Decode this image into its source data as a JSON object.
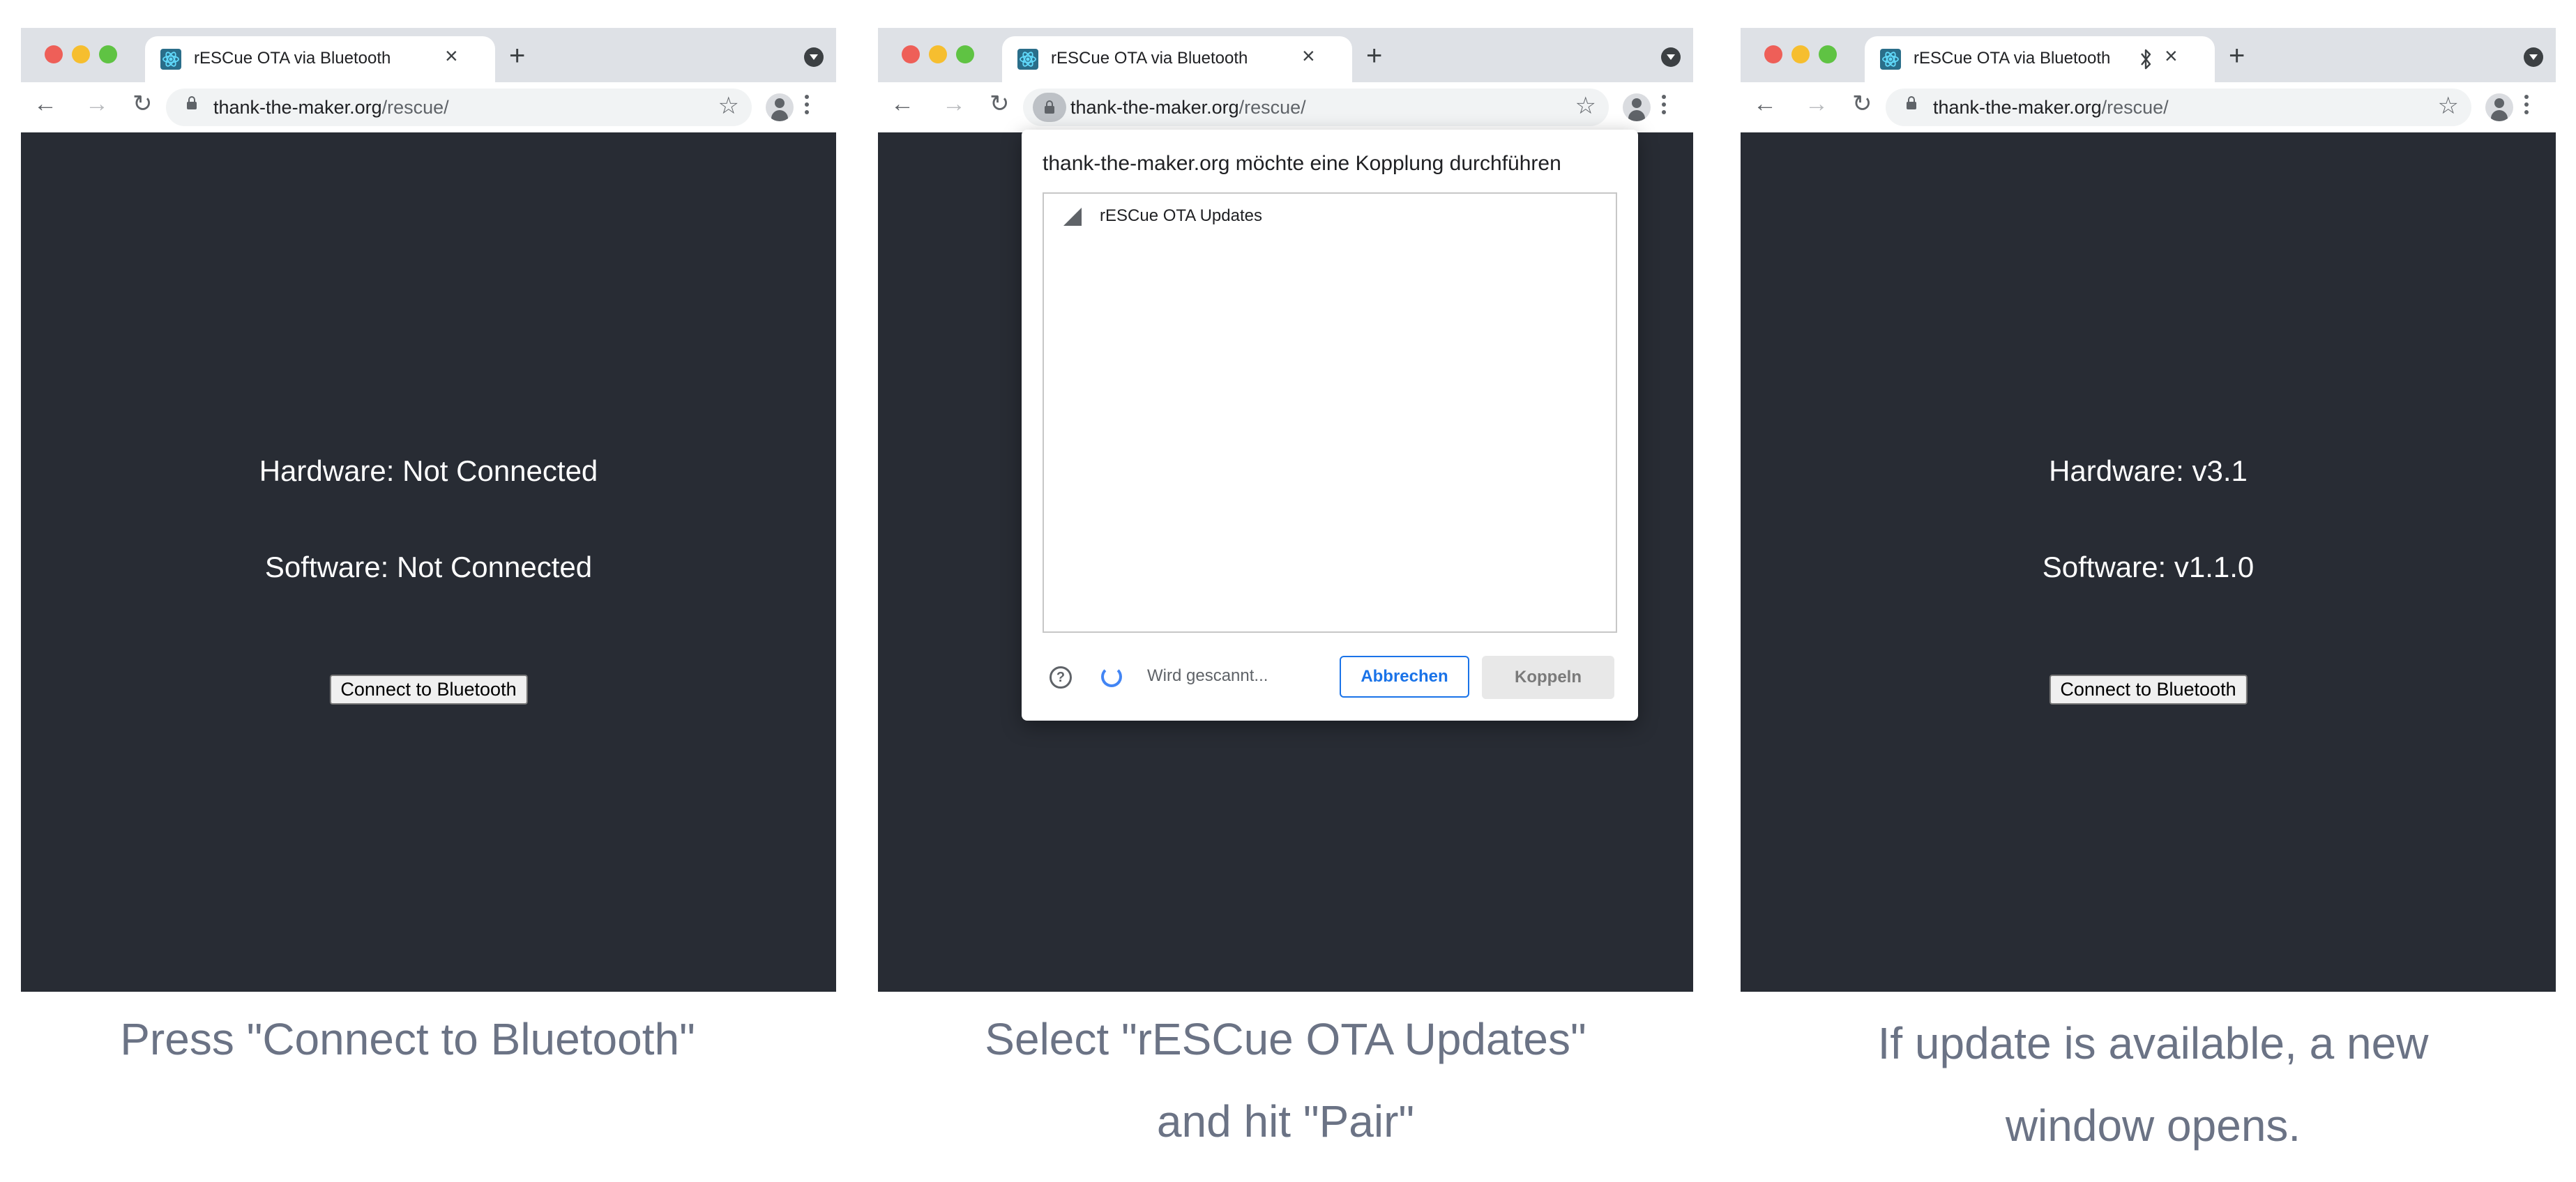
{
  "tab_title": "rESCue OTA via Bluetooth",
  "url": {
    "host": "thank-the-maker.org",
    "path": "/rescue/"
  },
  "panels": [
    {
      "hardware": "Hardware: Not Connected",
      "software": "Software: Not Connected",
      "button": "Connect to Bluetooth",
      "caption": "Press \"Connect to Bluetooth\""
    },
    {
      "dialog": {
        "title": "thank-the-maker.org möchte eine Kopplung durchführen",
        "device": "rESCue OTA Updates",
        "status": "Wird gescannt...",
        "cancel": "Abbrechen",
        "pair": "Koppeln"
      },
      "caption_line1": "Select \"rESCue OTA Updates\"",
      "caption_line2": "and hit \"Pair\""
    },
    {
      "hardware": "Hardware: v3.1",
      "software": "Software: v1.1.0",
      "button": "Connect to Bluetooth",
      "caption_line1": "If update is available, a new",
      "caption_line2": "window opens."
    }
  ],
  "icons": {
    "favicon": "react-atom-icon",
    "bluetooth": "bluetooth-icon",
    "close": "close-icon",
    "new_tab": "plus-icon",
    "back": "back-arrow-icon",
    "forward": "forward-arrow-icon",
    "reload": "reload-icon",
    "lock": "lock-icon",
    "bookmark": "star-icon",
    "profile": "avatar-icon",
    "menu": "kebab-icon"
  },
  "colors": {
    "page_bg": "#282c34",
    "tabstrip": "#dee1e6",
    "caption": "#6b7385",
    "accent": "#1a73e8"
  }
}
